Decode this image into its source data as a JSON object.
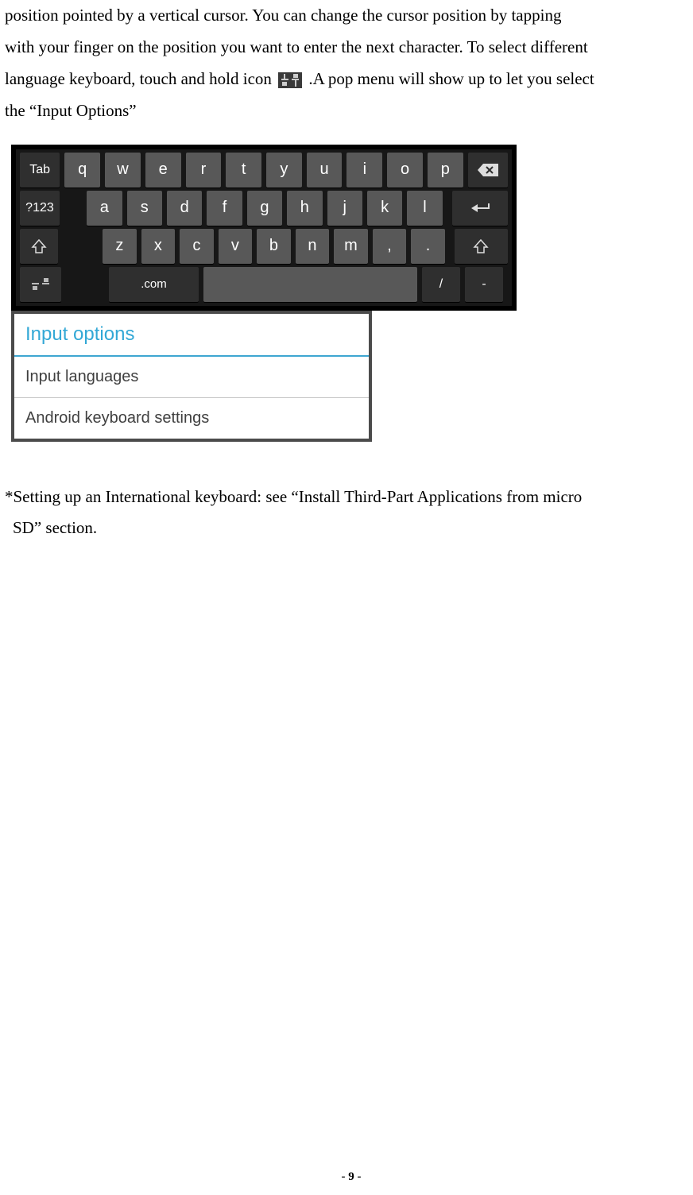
{
  "para1_a": "position pointed by a vertical cursor. You can change the cursor position by tapping",
  "para1_b": "with your finger on the position you want to enter the next character. To select different",
  "para1_c_pre": "language keyboard, touch and hold icon ",
  "para1_c_post": ".A pop menu will show up to let you select",
  "para1_d": "the “Input Options”",
  "keyboard": {
    "row1_side": "Tab",
    "row1": [
      "q",
      "w",
      "e",
      "r",
      "t",
      "y",
      "u",
      "i",
      "o",
      "p"
    ],
    "row2_side": "?123",
    "row2": [
      "a",
      "s",
      "d",
      "f",
      "g",
      "h",
      "j",
      "k",
      "l"
    ],
    "row3": [
      "z",
      "x",
      "c",
      "v",
      "b",
      "n",
      "m",
      ",",
      "."
    ],
    "row4_com": ".com",
    "row4_slash": "/",
    "row4_dash": "-"
  },
  "popup": {
    "header": "Input options",
    "item1": "Input languages",
    "item2": "Android keyboard settings"
  },
  "footnote_a": "*Setting up an International keyboard: see “Install Third-Part Applications from micro",
  "footnote_b": "SD” section.",
  "page_num": "- 9 -"
}
